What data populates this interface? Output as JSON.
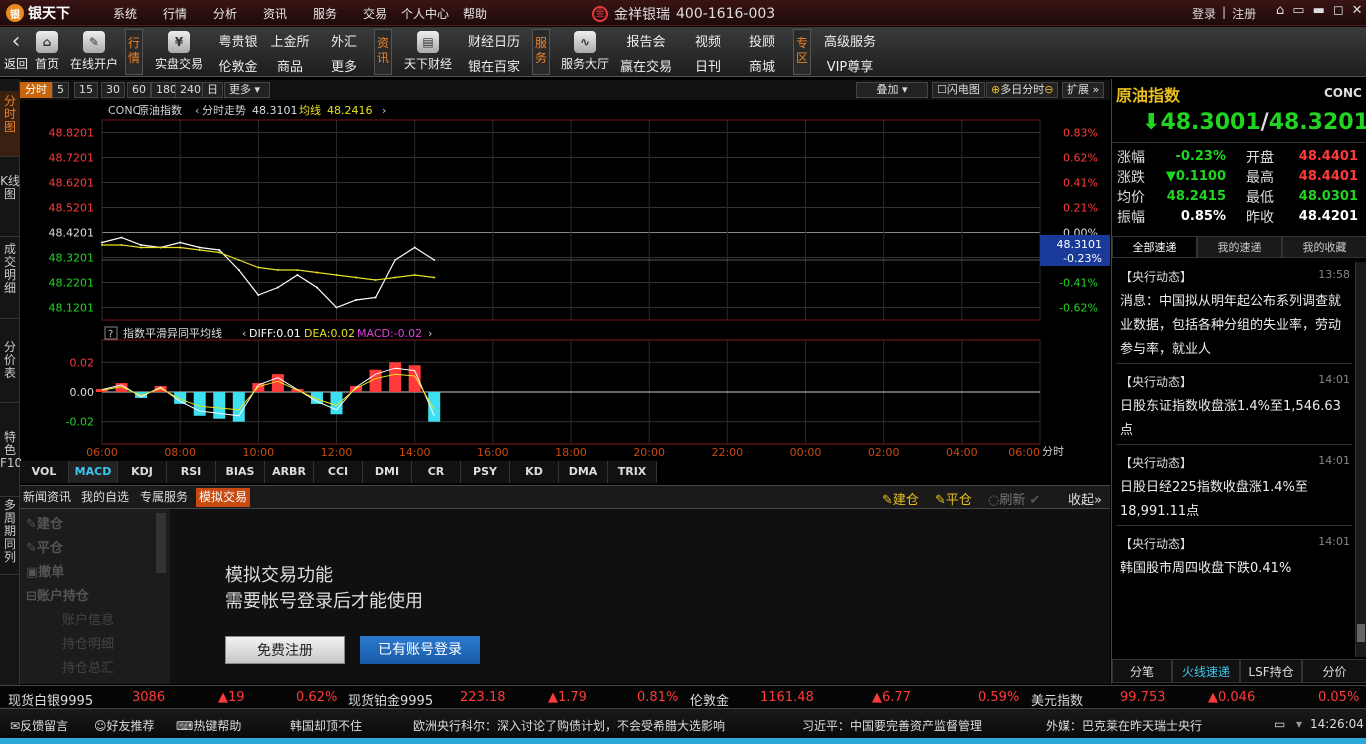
{
  "app": {
    "logo_text": "银天下",
    "logo_mark": "银",
    "brand": "金祥银瑞",
    "brand_mark": "金",
    "phone": "400-1616-003",
    "login": "登录",
    "register": "注册"
  },
  "menu": [
    "系统",
    "行情",
    "分析",
    "资讯",
    "服务",
    "交易",
    "个人中心",
    "帮助"
  ],
  "toolbar": {
    "back": "返回",
    "home": "首页",
    "open_account": "在线开户",
    "sec_quote": "行情",
    "real_trade": "实盘交易",
    "links1": [
      "粤贵银",
      "上金所",
      "外汇",
      "伦敦金",
      "商品",
      "更多"
    ],
    "sec_info": "资讯",
    "tianxia": "天下财经",
    "links2": [
      "财经日历",
      "银在百家"
    ],
    "sec_service": "服务",
    "service_hall": "服务大厅",
    "links3": [
      "报告会",
      "视频",
      "投顾",
      "赢在交易",
      "日刊",
      "商城"
    ],
    "sec_zone": "专区",
    "zone_links": [
      "高级服务",
      "VIP尊享"
    ]
  },
  "left_tabs": [
    "分时图",
    "K线图",
    "成交明细",
    "分价表",
    "特色F10",
    "多周期同列"
  ],
  "period_buttons": [
    "分时",
    "5",
    "15",
    "30",
    "60",
    "180",
    "240",
    "日",
    "更多"
  ],
  "chart_toolbar": {
    "overlay": "叠加",
    "flash": "闪电图",
    "multi_day": "多日分时",
    "expand": "扩展"
  },
  "chart_header": {
    "code": "CONC",
    "name": "原油指数",
    "mode": "分时走势",
    "price": "48.3101",
    "avg_label": "均线",
    "avg": "48.2416"
  },
  "macd_header": {
    "q": "?",
    "name": "指数平滑异同平均线",
    "diff": "DIFF:0.01",
    "dea": "DEA:0.02",
    "macd": "MACD:-0.02"
  },
  "price_axis": [
    "48.8201",
    "48.7201",
    "48.6201",
    "48.5201",
    "48.4201",
    "48.3201",
    "48.2201",
    "48.1201"
  ],
  "pct_axis": [
    "0.83%",
    "0.62%",
    "0.41%",
    "0.21%",
    "0.00%",
    "-0.21%",
    "-0.41%",
    "-0.62%"
  ],
  "macd_axis": [
    "0.02",
    "0.00",
    "-0.02"
  ],
  "time_axis": [
    "06:00",
    "08:00",
    "10:00",
    "12:00",
    "14:00",
    "16:00",
    "18:00",
    "20:00",
    "22:00",
    "00:00",
    "02:00",
    "04:00",
    "06:00"
  ],
  "time_unit": "分时",
  "cursor_box": {
    "price": "48.3101",
    "pct": "-0.23%"
  },
  "chart_data": {
    "type": "line",
    "title": "原油指数",
    "x_unit": "time",
    "x": [
      "06:00",
      "06:30",
      "07:00",
      "07:30",
      "08:00",
      "08:30",
      "09:00",
      "09:30",
      "10:00",
      "10:30",
      "11:00",
      "11:30",
      "12:00",
      "12:30",
      "13:00",
      "13:30",
      "14:00",
      "14:30"
    ],
    "series": [
      {
        "name": "CONC",
        "values": [
          48.38,
          48.4,
          48.37,
          48.36,
          48.38,
          48.36,
          48.35,
          48.27,
          48.17,
          48.2,
          48.25,
          48.2,
          48.12,
          48.15,
          48.16,
          48.31,
          48.36,
          48.31
        ]
      },
      {
        "name": "均线",
        "values": [
          48.37,
          48.37,
          48.36,
          48.36,
          48.36,
          48.35,
          48.34,
          48.31,
          48.28,
          48.27,
          48.27,
          48.26,
          48.25,
          48.24,
          48.23,
          48.24,
          48.25,
          48.24
        ]
      }
    ],
    "ylim": [
      48.0701,
      48.8701
    ],
    "prev_close": 48.4201,
    "macd": {
      "values": [
        0.002,
        0.006,
        -0.004,
        0.004,
        -0.008,
        -0.016,
        -0.018,
        -0.02,
        0.006,
        0.012,
        0.002,
        -0.008,
        -0.015,
        0.004,
        0.015,
        0.02,
        0.018,
        -0.02
      ],
      "ylim": [
        -0.035,
        0.035
      ]
    }
  },
  "indicators": [
    "VOL",
    "MACD",
    "KDJ",
    "RSI",
    "BIAS",
    "ARBR",
    "CCI",
    "DMI",
    "CR",
    "PSY",
    "KD",
    "DMA",
    "TRIX"
  ],
  "bottom_tabs": [
    "新闻资讯",
    "我的自选",
    "专属服务",
    "模拟交易"
  ],
  "bottom_controls": {
    "open": "建仓",
    "close": "平仓",
    "refresh": "刷新",
    "collapse": "收起"
  },
  "sim": {
    "items": [
      "建仓",
      "平仓",
      "撤单",
      "账户持仓"
    ],
    "subs": [
      "账户信息",
      "持仓明细",
      "持仓总汇"
    ],
    "msg1": "模拟交易功能",
    "msg2": "需要帐号登录后才能使用",
    "register": "免费注册",
    "login": "已有账号登录"
  },
  "quote": {
    "name": "原油指数",
    "code": "CONC",
    "bid": "48.3001",
    "ask": "48.3201",
    "rows": [
      {
        "l1": "涨幅",
        "v1": "-0.23%",
        "l2": "开盘",
        "v2": "48.4401"
      },
      {
        "l1": "涨跌",
        "v1": "0.1100",
        "l2": "最高",
        "v2": "48.4401"
      },
      {
        "l1": "均价",
        "v1": "48.2415",
        "l2": "最低",
        "v2": "48.0301"
      },
      {
        "l1": "振幅",
        "v1": "0.85%",
        "l2": "昨收",
        "v2": "48.4201"
      }
    ]
  },
  "news_tabs": [
    "全部速递",
    "我的速递",
    "我的收藏"
  ],
  "news": [
    {
      "src": "【央行动态】",
      "time": "13:58",
      "text": "消息：中国拟从明年起公布系列调查就业数据，包括各种分组的失业率，劳动参与率，就业人"
    },
    {
      "src": "【央行动态】",
      "time": "14:01",
      "text": "日股东证指数收盘涨1.4%至1,546.63点"
    },
    {
      "src": "【央行动态】",
      "time": "14:01",
      "text": "日股日经225指数收盘涨1.4%至18,991.11点"
    },
    {
      "src": "【央行动态】",
      "time": "14:01",
      "text": "韩国股市周四收盘下跌0.41%"
    }
  ],
  "right_bottom_tabs": [
    "分笔",
    "火线速递",
    "LSF持仓",
    "分价"
  ],
  "ticker": [
    {
      "name": "现货白银9995",
      "price": "3086",
      "chg": "19",
      "pct": "0.62%"
    },
    {
      "name": "现货铂金9995",
      "price": "223.18",
      "chg": "1.79",
      "pct": "0.81%"
    },
    {
      "name": "伦敦金",
      "price": "1161.48",
      "chg": "6.77",
      "pct": "0.59%"
    },
    {
      "name": "美元指数",
      "price": "99.753",
      "chg": "0.046",
      "pct": "0.05%"
    }
  ],
  "status": {
    "feedback": "反馈留言",
    "recommend": "好友推荐",
    "hotkey": "热键帮助",
    "time": "14:26:04",
    "headlines": [
      "韩国却顶不住",
      "欧洲央行科尔：深入讨论了购债计划，不会受希腊大选影响",
      "习近平：中国要完善资产监督管理",
      "外媒：巴克莱在昨天瑞士央行"
    ]
  },
  "colors": {
    "up": "#ff3a3a",
    "down": "#22d422",
    "accent": "#e9822a",
    "avg_line": "#e8e020",
    "price_line": "#ffffff",
    "macd_diff": "#ffffff",
    "macd_dea": "#e8e020"
  }
}
